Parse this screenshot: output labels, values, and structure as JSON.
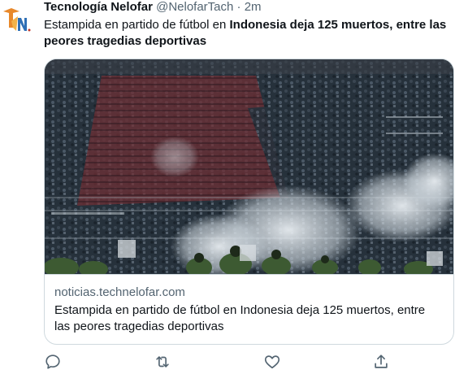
{
  "tweet": {
    "author_name": "Tecnología Nelofar",
    "handle": "@NelofarTach",
    "separator": "·",
    "time": "2m",
    "text_part1": "Estampida en partido de fútbol en ",
    "text_bold": "Indonesia deja 125 muertos, entre las peores tragedias deportivas"
  },
  "card": {
    "domain": "noticias.technelofar.com",
    "title": "Estampida en partido de fútbol en Indonesia deja 125 muertos, entre las peores tragedias deportivas"
  },
  "icons": {
    "reply": "reply-icon",
    "retweet": "retweet-icon",
    "like": "heart-icon",
    "share": "share-icon"
  },
  "colors": {
    "text": "#0f1419",
    "secondary": "#536471",
    "border": "#cfd9de"
  }
}
